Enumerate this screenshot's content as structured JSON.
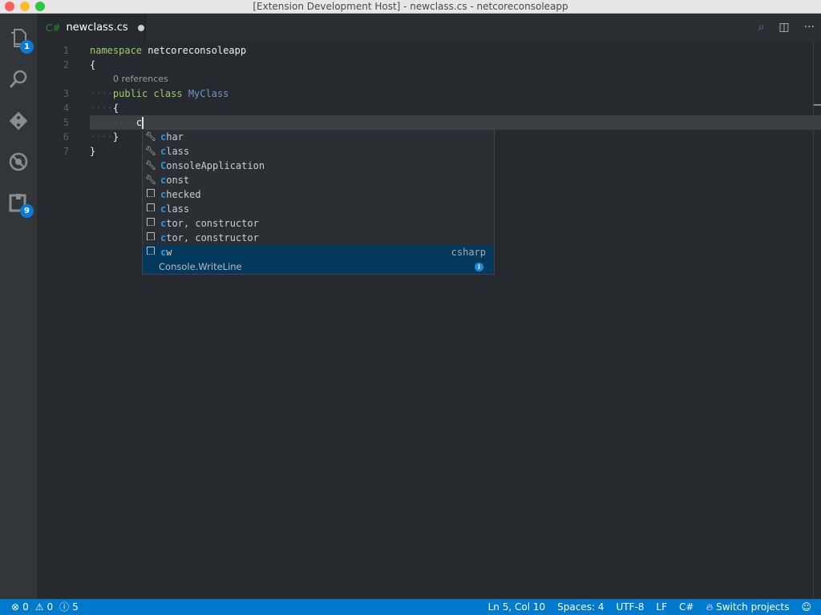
{
  "window": {
    "title": "[Extension Development Host] - newclass.cs - netcoreconsoleapp"
  },
  "activity": {
    "explorer_badge": "1",
    "extensions_badge": "9"
  },
  "tab": {
    "lang": "C#",
    "filename": "newclass.cs"
  },
  "editor": {
    "lines": [
      {
        "n": "1",
        "ws": "",
        "parts": [
          [
            "kw",
            "namespace"
          ],
          [
            "",
            "netcoreconsoleapp"
          ]
        ]
      },
      {
        "n": "2",
        "ws": "",
        "parts": [
          [
            "",
            "{"
          ]
        ]
      },
      {
        "n": "3",
        "ws": "····",
        "parts": [
          [
            "kw",
            "public class "
          ],
          [
            "ty",
            "MyClass"
          ]
        ]
      },
      {
        "n": "4",
        "ws": "····",
        "parts": [
          [
            "",
            "{"
          ]
        ]
      },
      {
        "n": "5",
        "ws": "········",
        "parts": [
          [
            "",
            "c"
          ]
        ]
      },
      {
        "n": "6",
        "ws": "····",
        "parts": [
          [
            "",
            "}"
          ]
        ]
      },
      {
        "n": "7",
        "ws": "",
        "parts": [
          [
            "",
            "}"
          ]
        ]
      }
    ],
    "codelens": "0 references"
  },
  "suggest": {
    "items": [
      {
        "icon": "wrench",
        "match": "c",
        "rest": "har"
      },
      {
        "icon": "wrench",
        "match": "c",
        "rest": "lass"
      },
      {
        "icon": "wrench",
        "match": "C",
        "rest": "onsoleApplication"
      },
      {
        "icon": "wrench",
        "match": "c",
        "rest": "onst"
      },
      {
        "icon": "snippet",
        "match": "c",
        "rest": "hecked"
      },
      {
        "icon": "snippet",
        "match": "c",
        "rest": "lass"
      },
      {
        "icon": "snippet",
        "match": "c",
        "rest": "tor, constructor"
      },
      {
        "icon": "snippet",
        "match": "c",
        "rest": "tor, constructor"
      },
      {
        "icon": "snippet",
        "match": "c",
        "rest": "w",
        "detail": "csharp",
        "selected": true
      }
    ],
    "doc": "Console.WriteLine"
  },
  "status": {
    "errors": "0",
    "warnings": "0",
    "infos": "5",
    "position": "Ln 5, Col 10",
    "spaces": "Spaces: 4",
    "encoding": "UTF-8",
    "eol": "LF",
    "language": "C#",
    "switch": "Switch projects"
  },
  "colors": {
    "status_bar": "#007acc",
    "accent": "#1e9bf0",
    "selection": "#04395e"
  }
}
